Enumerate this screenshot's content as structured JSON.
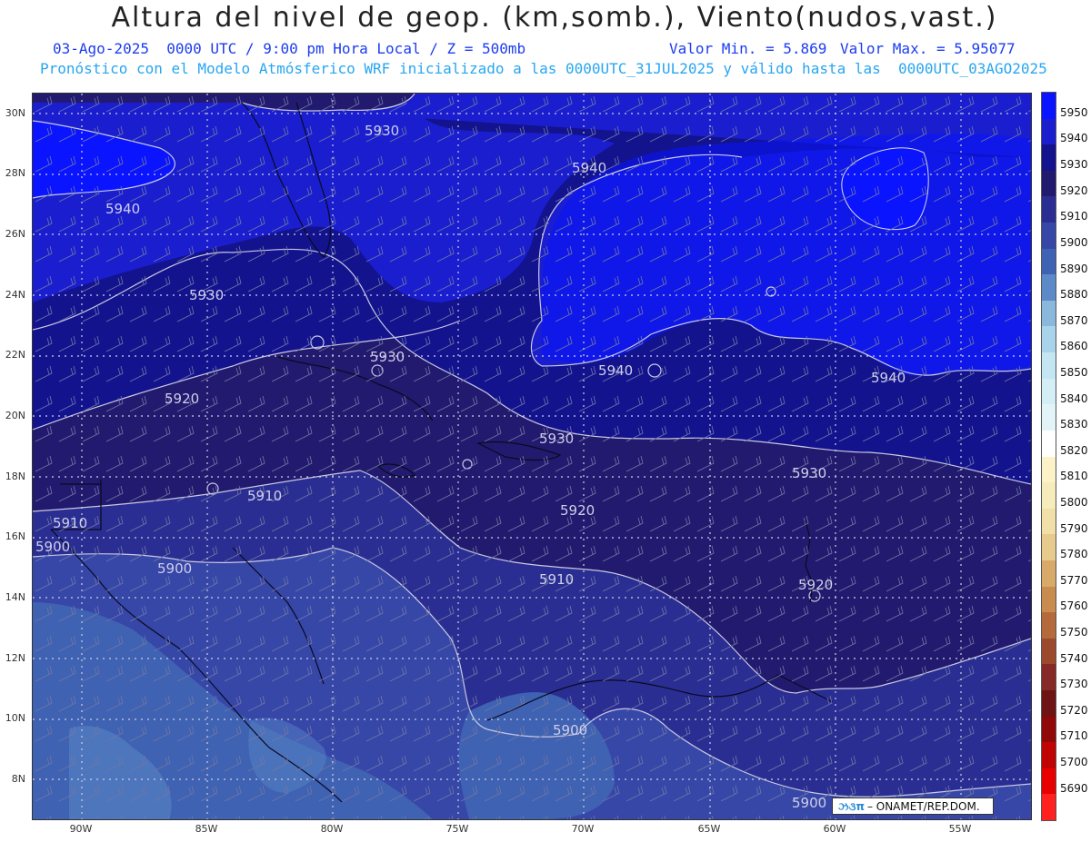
{
  "header": {
    "title": "Altura del nivel de geop. (km,somb.), Viento(nudos,vast.)",
    "date_line": "03-Ago-2025  0000 UTC / 9:00 pm Hora Local / Z = 500mb",
    "min_label": "Valor Min. = 5.869",
    "max_label": "Valor Max. = 5.95077",
    "model_line": "Pronóstico con el Modelo Atmósferico WRF inicializado a las 0000UTC_31JUL2025 y válido hasta las  0000UTC_03AGO2025"
  },
  "axes": {
    "lat_labels": [
      "30N",
      "28N",
      "26N",
      "24N",
      "22N",
      "20N",
      "18N",
      "16N",
      "14N",
      "12N",
      "10N",
      "8N"
    ],
    "lon_labels": [
      "90W",
      "85W",
      "80W",
      "75W",
      "70W",
      "65W",
      "60W",
      "55W"
    ]
  },
  "contour_labels": [
    "5930",
    "5940",
    "5940",
    "5930",
    "5930",
    "5940",
    "5940",
    "5920",
    "5930",
    "5930",
    "5910",
    "5920",
    "5910",
    "5900",
    "5900",
    "5910",
    "5920",
    "5900",
    "5900"
  ],
  "legend": {
    "levels": [
      "5950",
      "5940",
      "5930",
      "5920",
      "5910",
      "5900",
      "5890",
      "5880",
      "5870",
      "5860",
      "5850",
      "5840",
      "5830",
      "5820",
      "5810",
      "5800",
      "5790",
      "5780",
      "5770",
      "5760",
      "5750",
      "5740",
      "5730",
      "5720",
      "5710",
      "5700",
      "5690"
    ],
    "colors": [
      "#0a14ff",
      "#1a1ecf",
      "#13138e",
      "#221a6e",
      "#2a2e92",
      "#3647a8",
      "#3f62b2",
      "#5c8ac8",
      "#8ab8dd",
      "#a9d3ea",
      "#c3e6f2",
      "#d4eef6",
      "#e3f4f9",
      "#ffffff",
      "#fbf2c8",
      "#f6ebbb",
      "#f0dfa7",
      "#e7cb8d",
      "#d8aa6a",
      "#c98c4f",
      "#b46a3b",
      "#9c4a2e",
      "#852a26",
      "#6e1414",
      "#900808",
      "#c00404",
      "#e80000",
      "#ff2020"
    ]
  },
  "credit": {
    "logo": "ઝ૩π",
    "text": "– ONAMET/REP.DOM."
  }
}
